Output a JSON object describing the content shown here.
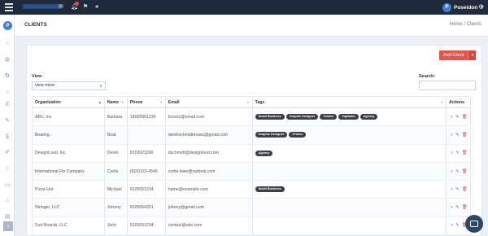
{
  "topbar": {
    "icons": [
      "mail-icon",
      "bell-icon",
      "flag-icon",
      "chat-icon",
      "gear-icon"
    ],
    "user_initial": "P",
    "user_name": "Poseidon"
  },
  "sidebar": {
    "avatar_initial": "P",
    "items": [
      "circle-icon",
      "globe-icon",
      "refresh-icon",
      "circle-icon",
      "phone-icon",
      "pencil-icon",
      "dollar-icon",
      "edit-icon",
      "star-icon",
      "folder-icon",
      "tag-icon",
      "trash-icon"
    ]
  },
  "header": {
    "title": "CLIENTS",
    "breadcrumb_home": "Home",
    "breadcrumb_sep": "/",
    "breadcrumb_current": "Clients"
  },
  "toolbar": {
    "add_label": "Add Client",
    "add_caret": "▾"
  },
  "filters": {
    "view_label": "View",
    "view_value": "view mine",
    "search_label": "Search:"
  },
  "table": {
    "columns": [
      "Organization",
      "Name",
      "Phone",
      "Email",
      "Tags",
      "Actions"
    ],
    "rows": [
      {
        "org": "ABC, Inc",
        "name": "Barbara",
        "phone": "18009991234",
        "email": "bcoors@email.com",
        "tags": [
          "Small Business",
          "Graphic Designer",
          "Vendor",
          "Capitalra",
          "Agency"
        ]
      },
      {
        "org": "Boating",
        "name": "Boat",
        "phone": "",
        "email": "derekschmidtmusic@gmail.com",
        "tags": [
          "Graphic Designer",
          "Vendor"
        ]
      },
      {
        "org": "DesignLoud, Inc",
        "name": "Derek",
        "phone": "9103023266",
        "email": "dschmidt@designloud.com",
        "tags": [
          "Agency"
        ]
      },
      {
        "org": "International Fin Company",
        "name": "Curtis",
        "phone": "(910)123-4545",
        "email": "curtis.lowe@outlook.com",
        "tags": []
      },
      {
        "org": "Pizza Hut",
        "name": "Michael",
        "phone": "9105551234",
        "email": "name@example.com",
        "tags": [
          "Small Business"
        ]
      },
      {
        "org": "Stringer, LLC",
        "name": "Johnny",
        "phone": "9105554321",
        "email": "johnny@gmail.com",
        "tags": []
      },
      {
        "org": "Surf Boards, LLC",
        "name": "John",
        "phone": "9105551234",
        "email": "contact@abc.com",
        "tags": []
      }
    ]
  },
  "colors": {
    "topbar": "#1f2a3c",
    "accent": "#3d7fd8",
    "add_button": "#e5554f",
    "tag": "#3a3f48"
  }
}
